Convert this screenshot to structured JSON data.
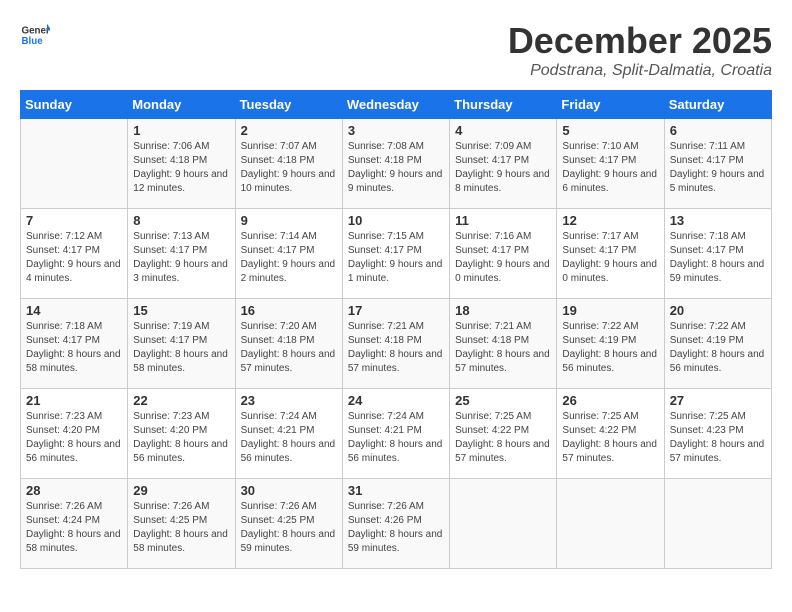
{
  "logo": {
    "general": "General",
    "blue": "Blue"
  },
  "title": {
    "month": "December 2025",
    "location": "Podstrana, Split-Dalmatia, Croatia"
  },
  "weekdays": [
    "Sunday",
    "Monday",
    "Tuesday",
    "Wednesday",
    "Thursday",
    "Friday",
    "Saturday"
  ],
  "weeks": [
    [
      {
        "day": "",
        "sunrise": "",
        "sunset": "",
        "daylight": ""
      },
      {
        "day": "1",
        "sunrise": "Sunrise: 7:06 AM",
        "sunset": "Sunset: 4:18 PM",
        "daylight": "Daylight: 9 hours and 12 minutes."
      },
      {
        "day": "2",
        "sunrise": "Sunrise: 7:07 AM",
        "sunset": "Sunset: 4:18 PM",
        "daylight": "Daylight: 9 hours and 10 minutes."
      },
      {
        "day": "3",
        "sunrise": "Sunrise: 7:08 AM",
        "sunset": "Sunset: 4:18 PM",
        "daylight": "Daylight: 9 hours and 9 minutes."
      },
      {
        "day": "4",
        "sunrise": "Sunrise: 7:09 AM",
        "sunset": "Sunset: 4:17 PM",
        "daylight": "Daylight: 9 hours and 8 minutes."
      },
      {
        "day": "5",
        "sunrise": "Sunrise: 7:10 AM",
        "sunset": "Sunset: 4:17 PM",
        "daylight": "Daylight: 9 hours and 6 minutes."
      },
      {
        "day": "6",
        "sunrise": "Sunrise: 7:11 AM",
        "sunset": "Sunset: 4:17 PM",
        "daylight": "Daylight: 9 hours and 5 minutes."
      }
    ],
    [
      {
        "day": "7",
        "sunrise": "Sunrise: 7:12 AM",
        "sunset": "Sunset: 4:17 PM",
        "daylight": "Daylight: 9 hours and 4 minutes."
      },
      {
        "day": "8",
        "sunrise": "Sunrise: 7:13 AM",
        "sunset": "Sunset: 4:17 PM",
        "daylight": "Daylight: 9 hours and 3 minutes."
      },
      {
        "day": "9",
        "sunrise": "Sunrise: 7:14 AM",
        "sunset": "Sunset: 4:17 PM",
        "daylight": "Daylight: 9 hours and 2 minutes."
      },
      {
        "day": "10",
        "sunrise": "Sunrise: 7:15 AM",
        "sunset": "Sunset: 4:17 PM",
        "daylight": "Daylight: 9 hours and 1 minute."
      },
      {
        "day": "11",
        "sunrise": "Sunrise: 7:16 AM",
        "sunset": "Sunset: 4:17 PM",
        "daylight": "Daylight: 9 hours and 0 minutes."
      },
      {
        "day": "12",
        "sunrise": "Sunrise: 7:17 AM",
        "sunset": "Sunset: 4:17 PM",
        "daylight": "Daylight: 9 hours and 0 minutes."
      },
      {
        "day": "13",
        "sunrise": "Sunrise: 7:18 AM",
        "sunset": "Sunset: 4:17 PM",
        "daylight": "Daylight: 8 hours and 59 minutes."
      }
    ],
    [
      {
        "day": "14",
        "sunrise": "Sunrise: 7:18 AM",
        "sunset": "Sunset: 4:17 PM",
        "daylight": "Daylight: 8 hours and 58 minutes."
      },
      {
        "day": "15",
        "sunrise": "Sunrise: 7:19 AM",
        "sunset": "Sunset: 4:17 PM",
        "daylight": "Daylight: 8 hours and 58 minutes."
      },
      {
        "day": "16",
        "sunrise": "Sunrise: 7:20 AM",
        "sunset": "Sunset: 4:18 PM",
        "daylight": "Daylight: 8 hours and 57 minutes."
      },
      {
        "day": "17",
        "sunrise": "Sunrise: 7:21 AM",
        "sunset": "Sunset: 4:18 PM",
        "daylight": "Daylight: 8 hours and 57 minutes."
      },
      {
        "day": "18",
        "sunrise": "Sunrise: 7:21 AM",
        "sunset": "Sunset: 4:18 PM",
        "daylight": "Daylight: 8 hours and 57 minutes."
      },
      {
        "day": "19",
        "sunrise": "Sunrise: 7:22 AM",
        "sunset": "Sunset: 4:19 PM",
        "daylight": "Daylight: 8 hours and 56 minutes."
      },
      {
        "day": "20",
        "sunrise": "Sunrise: 7:22 AM",
        "sunset": "Sunset: 4:19 PM",
        "daylight": "Daylight: 8 hours and 56 minutes."
      }
    ],
    [
      {
        "day": "21",
        "sunrise": "Sunrise: 7:23 AM",
        "sunset": "Sunset: 4:20 PM",
        "daylight": "Daylight: 8 hours and 56 minutes."
      },
      {
        "day": "22",
        "sunrise": "Sunrise: 7:23 AM",
        "sunset": "Sunset: 4:20 PM",
        "daylight": "Daylight: 8 hours and 56 minutes."
      },
      {
        "day": "23",
        "sunrise": "Sunrise: 7:24 AM",
        "sunset": "Sunset: 4:21 PM",
        "daylight": "Daylight: 8 hours and 56 minutes."
      },
      {
        "day": "24",
        "sunrise": "Sunrise: 7:24 AM",
        "sunset": "Sunset: 4:21 PM",
        "daylight": "Daylight: 8 hours and 56 minutes."
      },
      {
        "day": "25",
        "sunrise": "Sunrise: 7:25 AM",
        "sunset": "Sunset: 4:22 PM",
        "daylight": "Daylight: 8 hours and 57 minutes."
      },
      {
        "day": "26",
        "sunrise": "Sunrise: 7:25 AM",
        "sunset": "Sunset: 4:22 PM",
        "daylight": "Daylight: 8 hours and 57 minutes."
      },
      {
        "day": "27",
        "sunrise": "Sunrise: 7:25 AM",
        "sunset": "Sunset: 4:23 PM",
        "daylight": "Daylight: 8 hours and 57 minutes."
      }
    ],
    [
      {
        "day": "28",
        "sunrise": "Sunrise: 7:26 AM",
        "sunset": "Sunset: 4:24 PM",
        "daylight": "Daylight: 8 hours and 58 minutes."
      },
      {
        "day": "29",
        "sunrise": "Sunrise: 7:26 AM",
        "sunset": "Sunset: 4:25 PM",
        "daylight": "Daylight: 8 hours and 58 minutes."
      },
      {
        "day": "30",
        "sunrise": "Sunrise: 7:26 AM",
        "sunset": "Sunset: 4:25 PM",
        "daylight": "Daylight: 8 hours and 59 minutes."
      },
      {
        "day": "31",
        "sunrise": "Sunrise: 7:26 AM",
        "sunset": "Sunset: 4:26 PM",
        "daylight": "Daylight: 8 hours and 59 minutes."
      },
      {
        "day": "",
        "sunrise": "",
        "sunset": "",
        "daylight": ""
      },
      {
        "day": "",
        "sunrise": "",
        "sunset": "",
        "daylight": ""
      },
      {
        "day": "",
        "sunrise": "",
        "sunset": "",
        "daylight": ""
      }
    ]
  ]
}
